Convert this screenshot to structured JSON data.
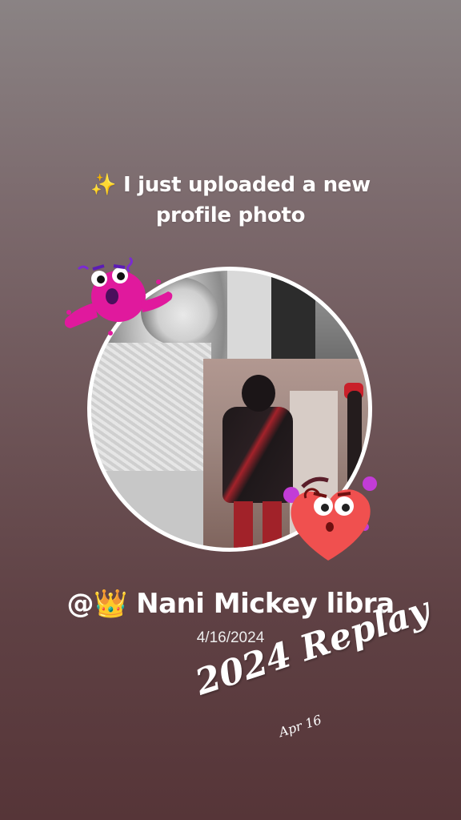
{
  "headline": {
    "sparkle": "✨",
    "line1": "I just uploaded a new",
    "line2": "profile photo"
  },
  "profile": {
    "handle_prefix": "@",
    "crown": "👑",
    "name": "Nani Mickey libra",
    "date": "4/16/2024"
  },
  "replay": {
    "title": "2024 Replay",
    "subtitle": "Apr 16"
  },
  "stickers": {
    "monster": "pink-monster-sticker",
    "heart": "heart-face-sticker"
  },
  "colors": {
    "sticker_pink": "#e0199d",
    "sticker_heart": "#f0504f"
  }
}
